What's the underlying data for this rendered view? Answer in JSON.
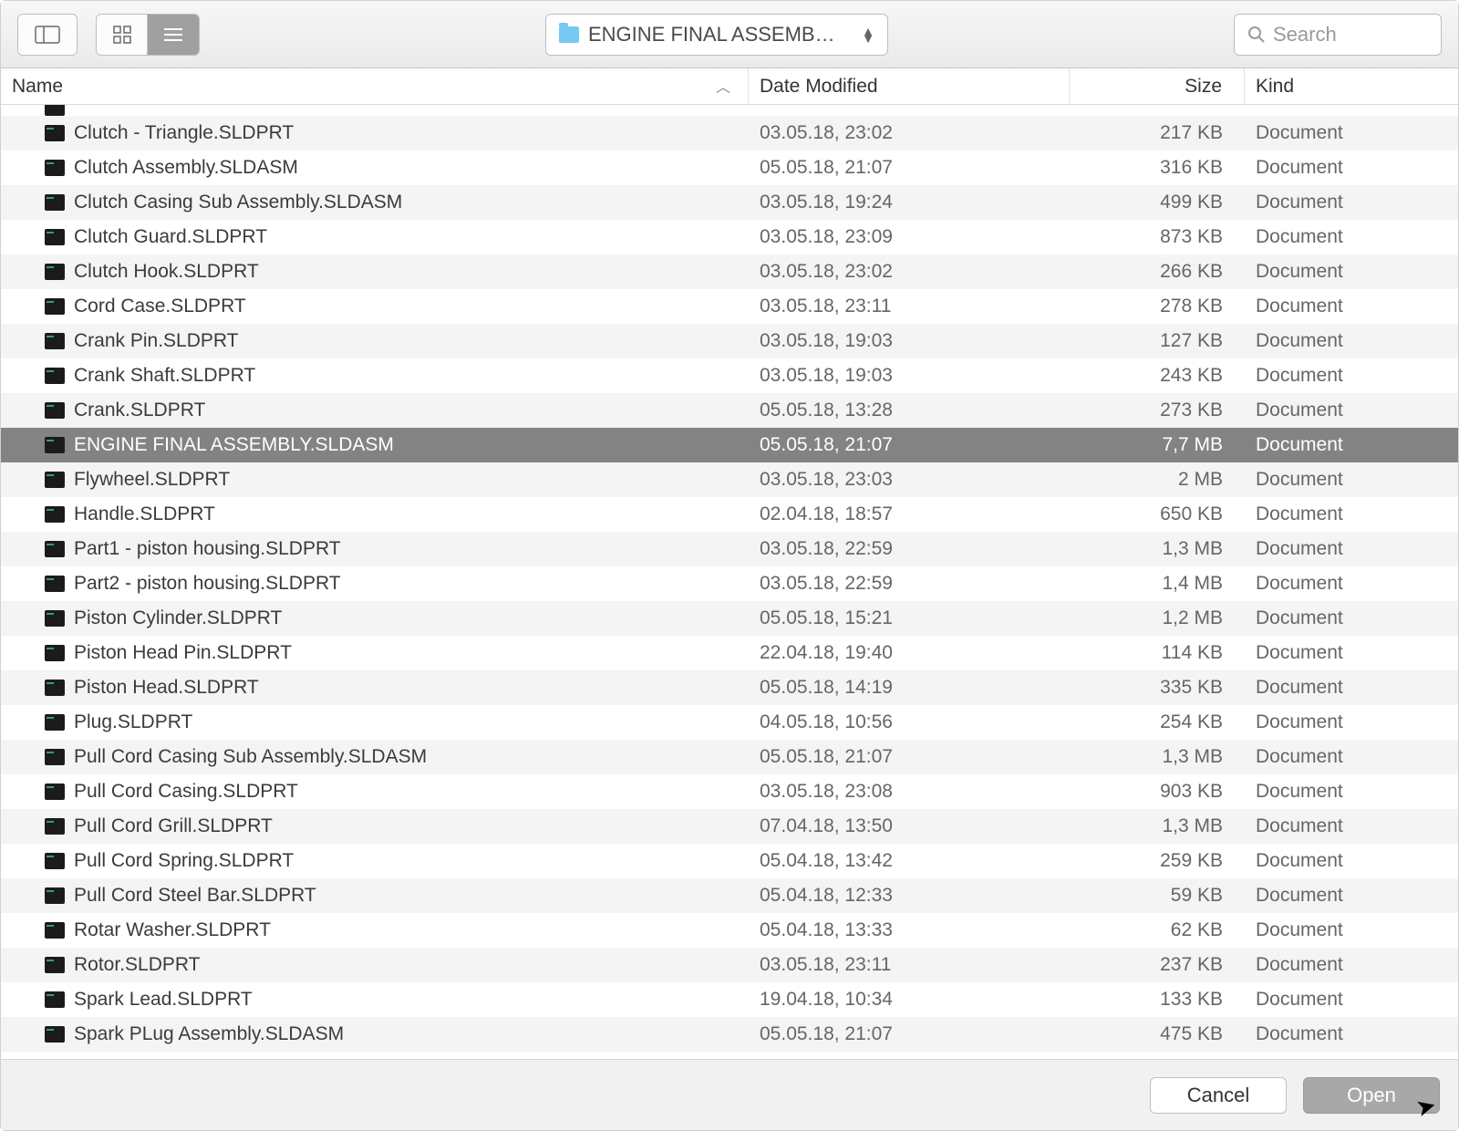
{
  "toolbar": {
    "path_label": "ENGINE FINAL ASSEMB…",
    "search_placeholder": "Search"
  },
  "columns": {
    "name": "Name",
    "date": "Date Modified",
    "size": "Size",
    "kind": "Kind"
  },
  "footer": {
    "cancel": "Cancel",
    "open": "Open"
  },
  "files": [
    {
      "name": "Clutch - Triangle.SLDPRT",
      "date": "03.05.18, 23:02",
      "size": "217 KB",
      "kind": "Document",
      "selected": false
    },
    {
      "name": "Clutch Assembly.SLDASM",
      "date": "05.05.18, 21:07",
      "size": "316 KB",
      "kind": "Document",
      "selected": false
    },
    {
      "name": "Clutch Casing Sub Assembly.SLDASM",
      "date": "03.05.18, 19:24",
      "size": "499 KB",
      "kind": "Document",
      "selected": false
    },
    {
      "name": "Clutch Guard.SLDPRT",
      "date": "03.05.18, 23:09",
      "size": "873 KB",
      "kind": "Document",
      "selected": false
    },
    {
      "name": "Clutch Hook.SLDPRT",
      "date": "03.05.18, 23:02",
      "size": "266 KB",
      "kind": "Document",
      "selected": false
    },
    {
      "name": "Cord Case.SLDPRT",
      "date": "03.05.18, 23:11",
      "size": "278 KB",
      "kind": "Document",
      "selected": false
    },
    {
      "name": "Crank Pin.SLDPRT",
      "date": "03.05.18, 19:03",
      "size": "127 KB",
      "kind": "Document",
      "selected": false
    },
    {
      "name": "Crank Shaft.SLDPRT",
      "date": "03.05.18, 19:03",
      "size": "243 KB",
      "kind": "Document",
      "selected": false
    },
    {
      "name": "Crank.SLDPRT",
      "date": "05.05.18, 13:28",
      "size": "273 KB",
      "kind": "Document",
      "selected": false
    },
    {
      "name": "ENGINE FINAL ASSEMBLY.SLDASM",
      "date": "05.05.18, 21:07",
      "size": "7,7 MB",
      "kind": "Document",
      "selected": true
    },
    {
      "name": "Flywheel.SLDPRT",
      "date": "03.05.18, 23:03",
      "size": "2 MB",
      "kind": "Document",
      "selected": false
    },
    {
      "name": "Handle.SLDPRT",
      "date": "02.04.18, 18:57",
      "size": "650 KB",
      "kind": "Document",
      "selected": false
    },
    {
      "name": "Part1 - piston housing.SLDPRT",
      "date": "03.05.18, 22:59",
      "size": "1,3 MB",
      "kind": "Document",
      "selected": false
    },
    {
      "name": "Part2 - piston housing.SLDPRT",
      "date": "03.05.18, 22:59",
      "size": "1,4 MB",
      "kind": "Document",
      "selected": false
    },
    {
      "name": "Piston Cylinder.SLDPRT",
      "date": "05.05.18, 15:21",
      "size": "1,2 MB",
      "kind": "Document",
      "selected": false
    },
    {
      "name": "Piston Head Pin.SLDPRT",
      "date": "22.04.18, 19:40",
      "size": "114 KB",
      "kind": "Document",
      "selected": false
    },
    {
      "name": "Piston Head.SLDPRT",
      "date": "05.05.18, 14:19",
      "size": "335 KB",
      "kind": "Document",
      "selected": false
    },
    {
      "name": "Plug.SLDPRT",
      "date": "04.05.18, 10:56",
      "size": "254 KB",
      "kind": "Document",
      "selected": false
    },
    {
      "name": "Pull Cord Casing Sub Assembly.SLDASM",
      "date": "05.05.18, 21:07",
      "size": "1,3 MB",
      "kind": "Document",
      "selected": false
    },
    {
      "name": "Pull Cord Casing.SLDPRT",
      "date": "03.05.18, 23:08",
      "size": "903 KB",
      "kind": "Document",
      "selected": false
    },
    {
      "name": "Pull Cord Grill.SLDPRT",
      "date": "07.04.18, 13:50",
      "size": "1,3 MB",
      "kind": "Document",
      "selected": false
    },
    {
      "name": "Pull Cord Spring.SLDPRT",
      "date": "05.04.18, 13:42",
      "size": "259 KB",
      "kind": "Document",
      "selected": false
    },
    {
      "name": "Pull Cord Steel Bar.SLDPRT",
      "date": "05.04.18, 12:33",
      "size": "59 KB",
      "kind": "Document",
      "selected": false
    },
    {
      "name": "Rotar Washer.SLDPRT",
      "date": "05.04.18, 13:33",
      "size": "62 KB",
      "kind": "Document",
      "selected": false
    },
    {
      "name": "Rotor.SLDPRT",
      "date": "03.05.18, 23:11",
      "size": "237 KB",
      "kind": "Document",
      "selected": false
    },
    {
      "name": "Spark Lead.SLDPRT",
      "date": "19.04.18, 10:34",
      "size": "133 KB",
      "kind": "Document",
      "selected": false
    },
    {
      "name": "Spark PLug Assembly.SLDASM",
      "date": "05.05.18, 21:07",
      "size": "475 KB",
      "kind": "Document",
      "selected": false
    }
  ]
}
